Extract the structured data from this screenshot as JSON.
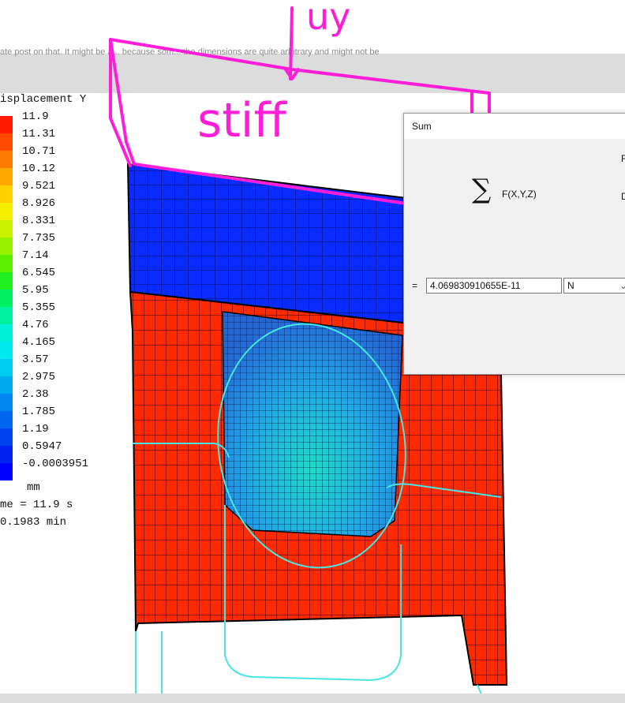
{
  "forum_text": {
    "line1": "ate post on that. It might be a... because som... the dimensions are quite arbitrary and might not be",
    "line2": "."
  },
  "legend": {
    "title": "isplacement Y",
    "values": [
      "11.9",
      "11.31",
      "10.71",
      "10.12",
      "9.521",
      "8.926",
      "8.331",
      "7.735",
      "7.14",
      "6.545",
      "5.95",
      "5.355",
      "4.76",
      "4.165",
      "3.57",
      "2.975",
      "2.38",
      "1.785",
      "1.19",
      "0.5947",
      "-0.0003951"
    ],
    "colors": [
      "#ff1a00",
      "#ff4a00",
      "#ff7a00",
      "#ffa800",
      "#ffd000",
      "#f4ee00",
      "#c8f000",
      "#98f000",
      "#5af000",
      "#20f020",
      "#00f060",
      "#00f0a0",
      "#00f0d8",
      "#00e8f0",
      "#00ccf0",
      "#00aaf0",
      "#0088f0",
      "#0066f0",
      "#0044f0",
      "#0022f0",
      "#0000ff"
    ],
    "unit": "mm",
    "time1": "me = 11.9 s",
    "time2": "0.1983 min"
  },
  "dialog": {
    "title": "Sum",
    "sigma": "∑",
    "function": "F(X,Y,Z)",
    "label_f": "F",
    "label_d": "D",
    "equals": "=",
    "result": "4.069830910655E-11",
    "unit": "N",
    "chevron": "⌄"
  },
  "annotation": {
    "top": "uy",
    "middle": "stiff",
    "color": "#ff1ed7"
  },
  "mesh": {
    "top_color": "#0a2bff",
    "bottom_color": "#ff2a00",
    "inner_color": "#2d9cf5",
    "line_color": "#46e6e6"
  }
}
